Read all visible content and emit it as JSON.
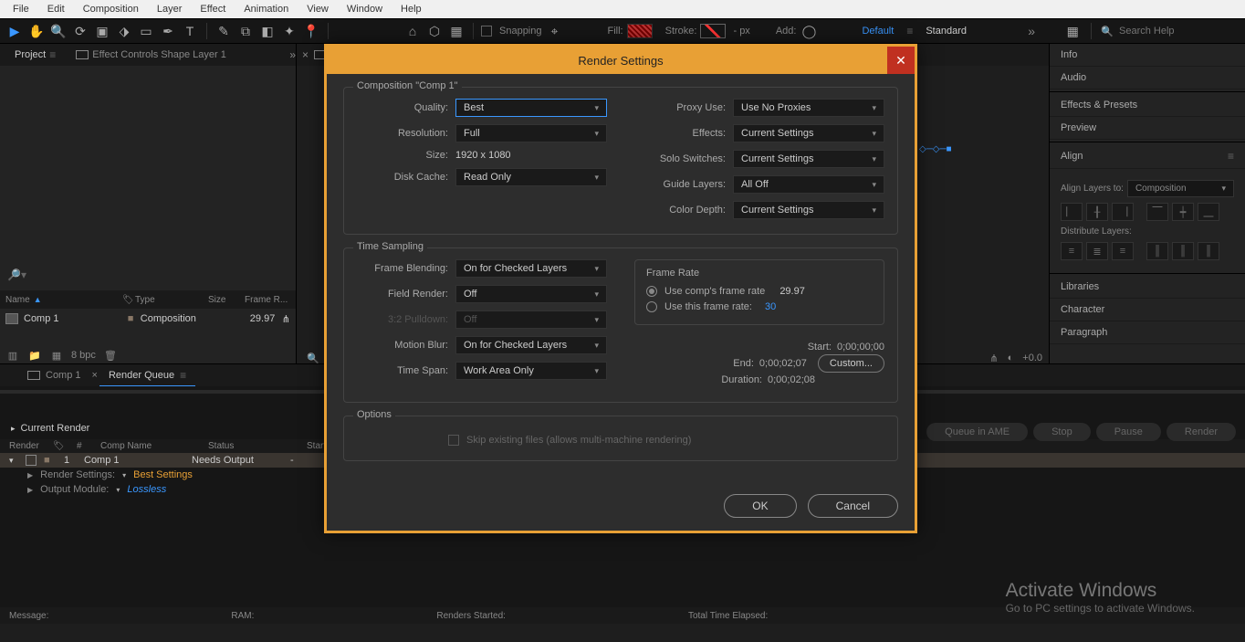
{
  "menu": {
    "items": [
      "File",
      "Edit",
      "Composition",
      "Layer",
      "Effect",
      "Animation",
      "View",
      "Window",
      "Help"
    ]
  },
  "toolbar": {
    "snapping": "Snapping",
    "fill": "Fill:",
    "stroke": "Stroke:",
    "stroke_px": "- px",
    "add": "Add:",
    "ws_default": "Default",
    "ws_standard": "Standard",
    "search_ph": "Search Help"
  },
  "tabs": {
    "project": "Project",
    "fx": "Effect Controls Shape Layer 1"
  },
  "project": {
    "cols": {
      "name": "Name",
      "type": "Type",
      "size": "Size",
      "fr": "Frame R..."
    },
    "row": {
      "name": "Comp 1",
      "type": "Composition",
      "fr": "29.97"
    },
    "bpc": "8 bpc"
  },
  "right": {
    "info": "Info",
    "audio": "Audio",
    "fx": "Effects & Presets",
    "preview": "Preview",
    "align": "Align",
    "align_layers": "Align Layers to:",
    "align_target": "Composition",
    "dist": "Distribute Layers:",
    "libraries": "Libraries",
    "character": "Character",
    "paragraph": "Paragraph"
  },
  "tl_footer_exposure": "+0.0",
  "lower": {
    "tab1": "Comp 1",
    "tab2": "Render Queue",
    "current": "Current Render",
    "btn_ame": "Queue in AME",
    "btn_stop": "Stop",
    "btn_pause": "Pause",
    "btn_render": "Render",
    "head": {
      "render": "Render",
      "tag": "",
      "num": "#",
      "comp": "Comp Name",
      "status": "Status",
      "started": "Started"
    },
    "row": {
      "num": "1",
      "comp": "Comp 1",
      "status": "Needs Output",
      "started": "-"
    },
    "rs_label": "Render Settings:",
    "rs_val": "Best Settings",
    "om_label": "Output Module:",
    "om_val": "Lossless"
  },
  "status": {
    "msg": "Message:",
    "ram": "RAM:",
    "rs": "Renders Started:",
    "tt": "Total Time Elapsed:"
  },
  "activate": {
    "big": "Activate Windows",
    "small": "Go to PC settings to activate Windows."
  },
  "dialog": {
    "title": "Render Settings",
    "comp_label": "Composition \"Comp 1\"",
    "quality_l": "Quality:",
    "quality_v": "Best",
    "res_l": "Resolution:",
    "res_v": "Full",
    "size_l": "Size:",
    "size_v": "1920 x 1080",
    "cache_l": "Disk Cache:",
    "cache_v": "Read Only",
    "proxy_l": "Proxy Use:",
    "proxy_v": "Use No Proxies",
    "fx_l": "Effects:",
    "fx_v": "Current Settings",
    "solo_l": "Solo Switches:",
    "solo_v": "Current Settings",
    "guide_l": "Guide Layers:",
    "guide_v": "All Off",
    "depth_l": "Color Depth:",
    "depth_v": "Current Settings",
    "ts_label": "Time Sampling",
    "fb_l": "Frame Blending:",
    "fb_v": "On for Checked Layers",
    "fr_l": "Field Render:",
    "fr_v": "Off",
    "pd_l": "3:2 Pulldown:",
    "pd_v": "Off",
    "mb_l": "Motion Blur:",
    "mb_v": "On for Checked Layers",
    "span_l": "Time Span:",
    "span_v": "Work Area Only",
    "frate_title": "Frame Rate",
    "frate_comp": "Use comp's frame rate",
    "frate_comp_v": "29.97",
    "frate_this": "Use this frame rate:",
    "frate_this_v": "30",
    "start_l": "Start:",
    "start_v": "0;00;00;00",
    "end_l": "End:",
    "end_v": "0;00;02;07",
    "dur_l": "Duration:",
    "dur_v": "0;00;02;08",
    "custom": "Custom...",
    "opt_label": "Options",
    "skip": "Skip existing files (allows multi-machine rendering)",
    "ok": "OK",
    "cancel": "Cancel"
  }
}
